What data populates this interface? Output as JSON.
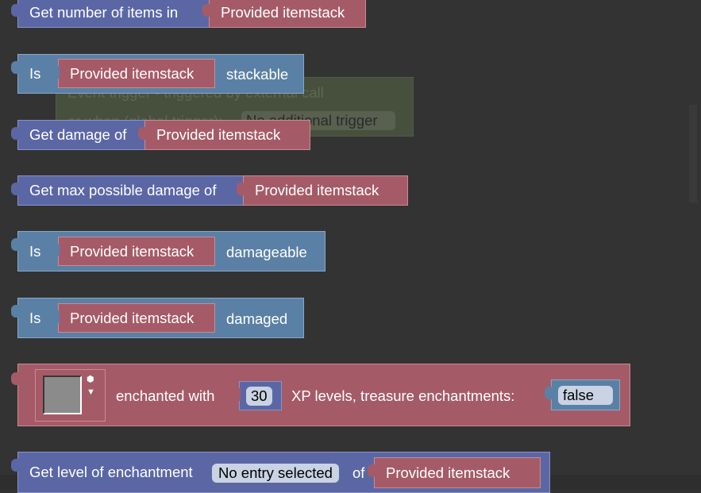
{
  "ghost_block": {
    "line1": "Event trigger - triggered by external call",
    "line2": "or when (global trigger):",
    "dropdown": "No additional trigger"
  },
  "blocks": [
    {
      "label": "Get number of items in",
      "input": "Provided itemstack"
    },
    {
      "prefix": "Is",
      "input": "Provided itemstack",
      "suffix": "stackable"
    },
    {
      "label": "Get damage of",
      "input": "Provided itemstack"
    },
    {
      "label": "Get max possible damage of",
      "input": "Provided itemstack"
    },
    {
      "prefix": "Is",
      "input": "Provided itemstack",
      "suffix": "damageable"
    },
    {
      "prefix": "Is",
      "input": "Provided itemstack",
      "suffix": "damaged"
    }
  ],
  "enchant_block": {
    "label1": "enchanted with",
    "levels": "30",
    "label2": "XP levels, treasure enchantments:",
    "treasure": "false"
  },
  "level_block": {
    "label": "Get level of enchantment",
    "dropdown": "No entry selected",
    "of": "of",
    "input": "Provided itemstack"
  }
}
